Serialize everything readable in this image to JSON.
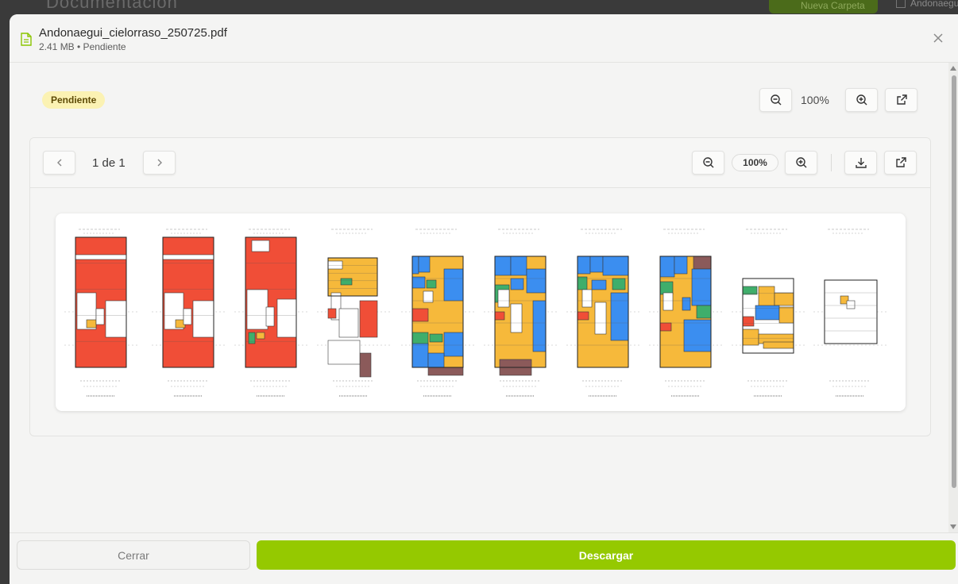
{
  "background": {
    "page_title": "Documentación",
    "new_folder_label": "Nueva Carpeta",
    "user_name": "Andonaegui"
  },
  "modal": {
    "file_name": "Andonaegui_cielorraso_250725.pdf",
    "file_meta": "2.41 MB • Pendiente",
    "close_icon": "close-icon",
    "status_badge": "Pendiente",
    "top_zoom": "100%",
    "viewer": {
      "page_current": "1",
      "page_sep": "de",
      "page_total": "1",
      "zoom": "100%"
    },
    "footer": {
      "close_label": "Cerrar",
      "download_label": "Descargar"
    }
  },
  "colors": {
    "accent": "#95c900",
    "badge_bg": "#fbf2b3",
    "plan_red": "#f04e37",
    "plan_blue": "#3b8ef0",
    "plan_yellow": "#f6b93b",
    "plan_green": "#3fae6b",
    "plan_brown": "#8b5a5a"
  }
}
